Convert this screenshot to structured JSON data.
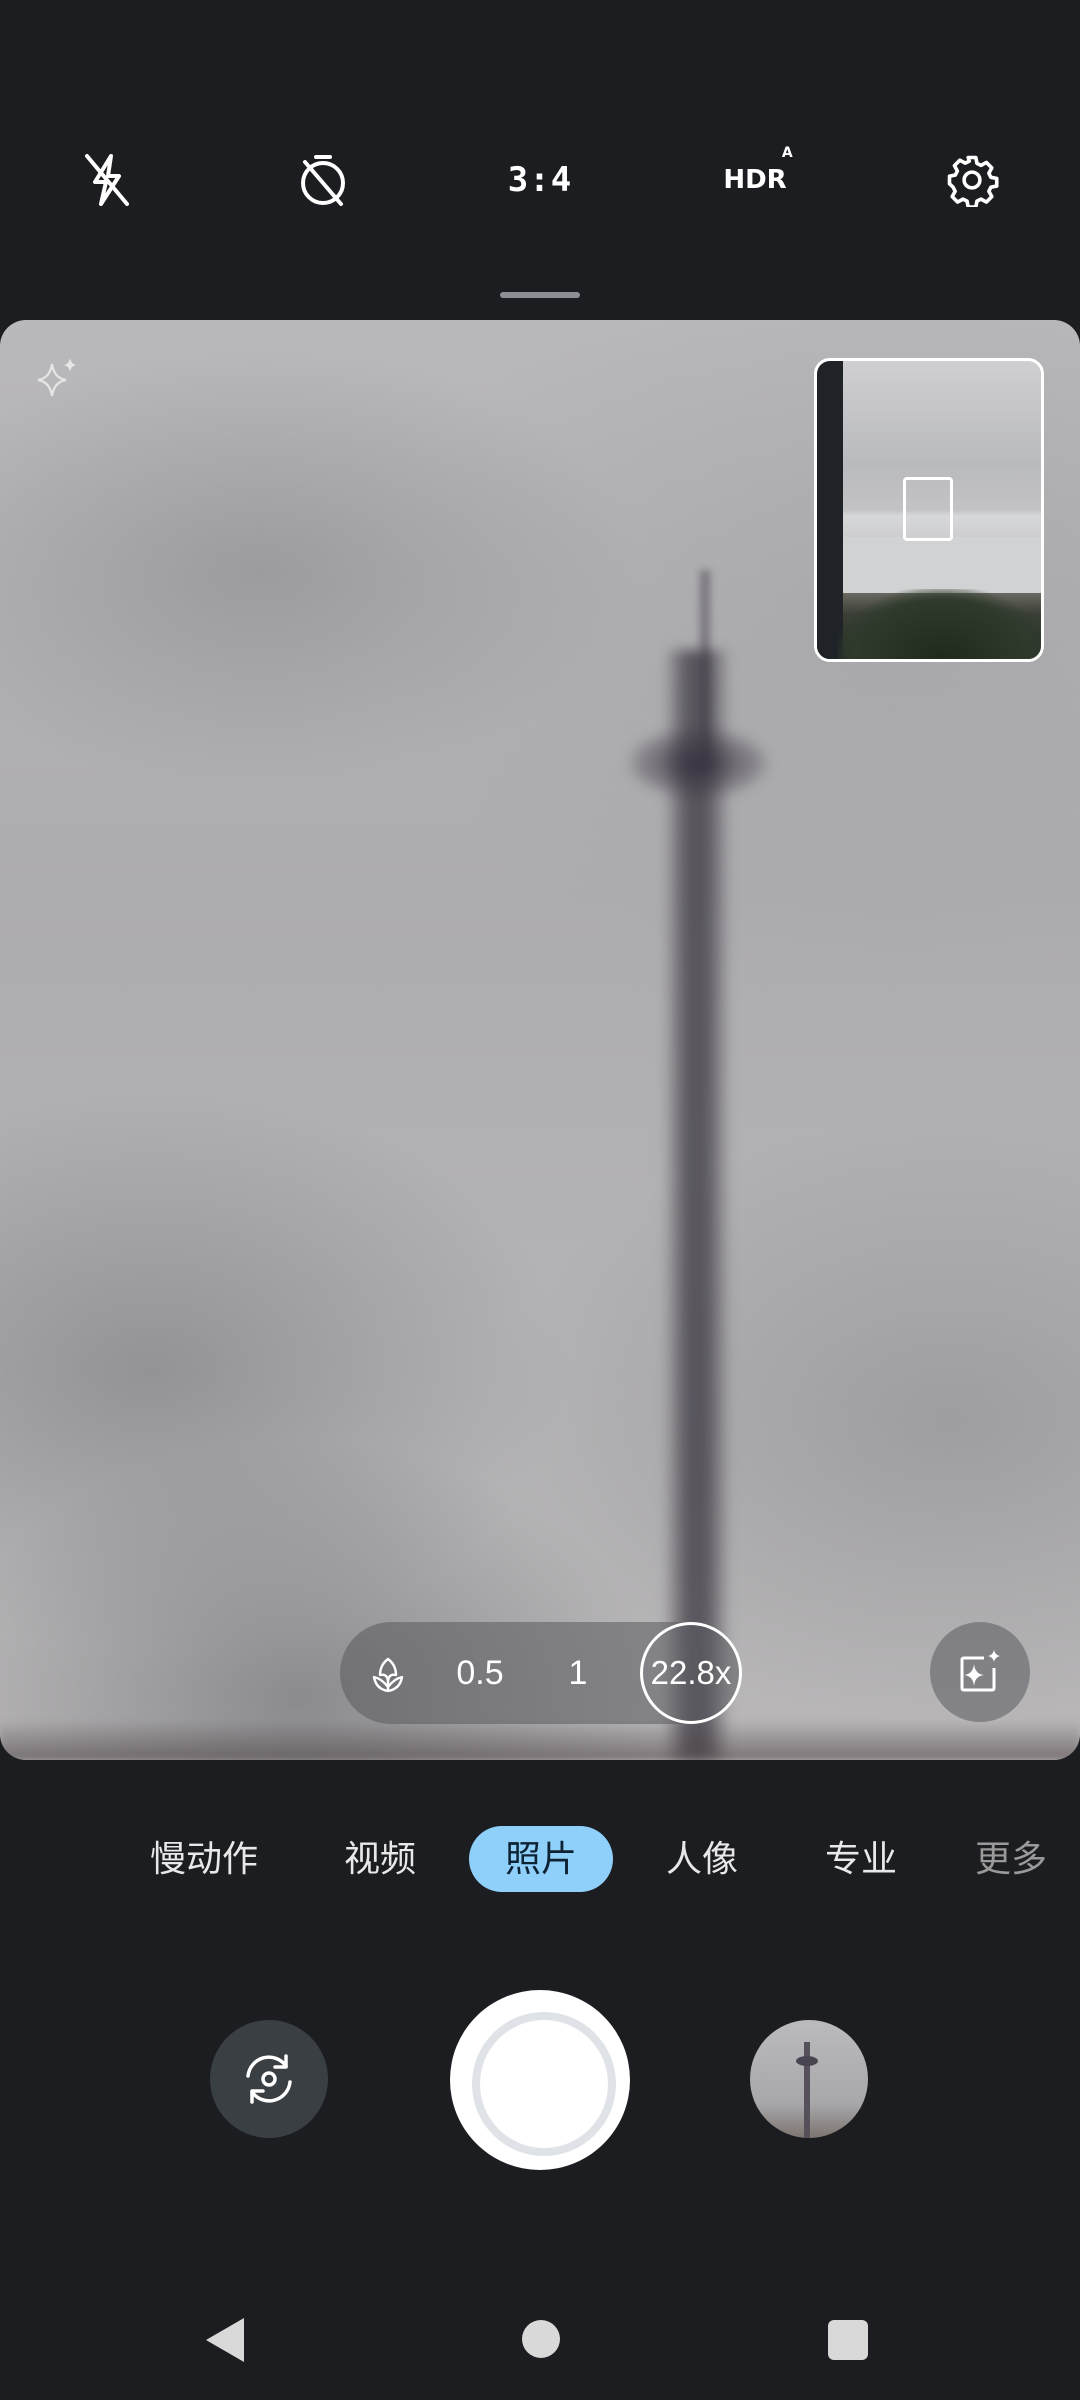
{
  "topbar": {
    "flash": "flash-off-icon",
    "timer": "timer-off-icon",
    "aspect_ratio": "3:4",
    "hdr_label": "HDR",
    "hdr_mode": "A",
    "settings": "gear-icon"
  },
  "viewfinder": {
    "ai_indicator": "sparkle-icon"
  },
  "zoom": {
    "macro_icon": "tulip-icon",
    "levels": [
      "0.5",
      "1"
    ],
    "current": "22.8x"
  },
  "ai_edit_icon": "ai-photo-icon",
  "modes": {
    "items": [
      "慢动作",
      "视频",
      "照片",
      "人像",
      "专业",
      "更多"
    ],
    "active": "照片"
  },
  "colors": {
    "background": "#1b1d20",
    "active_mode": "#8fd0fb"
  }
}
